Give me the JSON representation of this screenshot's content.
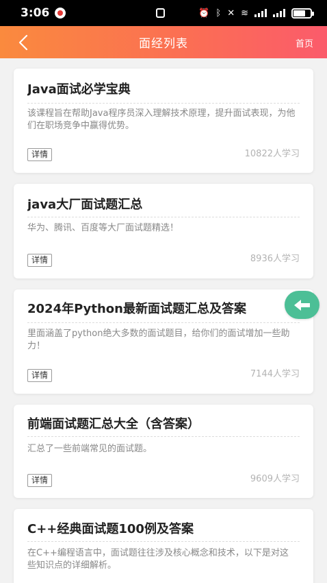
{
  "status_bar": {
    "time": "3:06",
    "battery_level": 0.7
  },
  "header": {
    "title": "面经列表",
    "home_label": "首页"
  },
  "detail_label": "详情",
  "courses": [
    {
      "title": "Java面试必学宝典",
      "description": "该课程旨在帮助Java程序员深入理解技术原理，提升面试表现，为他们在职场竞争中赢得优势。",
      "learners": "10822人学习"
    },
    {
      "title": "java大厂面试题汇总",
      "description": "华为、腾讯、百度等大厂面试题精选！",
      "learners": "8936人学习"
    },
    {
      "title": "2024年Python最新面试题汇总及答案",
      "description": "里面涵盖了python绝大多数的面试题目，给你们的面试增加一些助力！",
      "learners": "7144人学习"
    },
    {
      "title": "前端面试题汇总大全（含答案）",
      "description": "汇总了一些前端常见的面试题。",
      "learners": "9609人学习"
    },
    {
      "title": "C++经典面试题100例及答案",
      "description": "在C++编程语言中，面试题往往涉及核心概念和技术，以下是对这些知识点的详细解析。"
    }
  ],
  "colors": {
    "header_gradient_start": "#fa8a3e",
    "header_gradient_end": "#fb5b6b",
    "float_button": "#4cbf96"
  },
  "icons": {
    "back": "chevron-left-icon",
    "float": "arrow-left-icon"
  }
}
